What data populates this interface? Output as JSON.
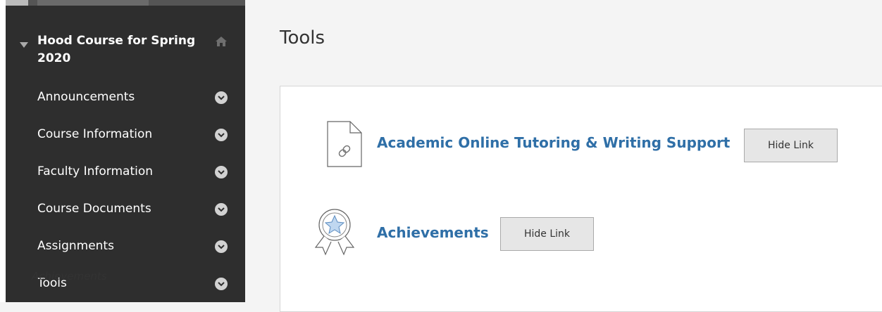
{
  "sidebar": {
    "course_title": "Hood Course for Spring 2020",
    "items": [
      {
        "label": "Announcements"
      },
      {
        "label": "Course Information"
      },
      {
        "label": "Faculty Information"
      },
      {
        "label": "Course Documents"
      },
      {
        "label": "Assignments"
      },
      {
        "label": "Tools"
      }
    ]
  },
  "main": {
    "title": "Tools",
    "tools": [
      {
        "name": "Academic Online Tutoring & Writing Support",
        "button": "Hide Link",
        "icon": "link-document-icon"
      },
      {
        "name": "Achievements",
        "button": "Hide Link",
        "icon": "achievement-badge-icon",
        "caption": "Achievements"
      }
    ]
  },
  "colors": {
    "sidebar_bg": "#2e2e2e",
    "link": "#2f6fa7",
    "button_bg": "#e6e6e6"
  }
}
